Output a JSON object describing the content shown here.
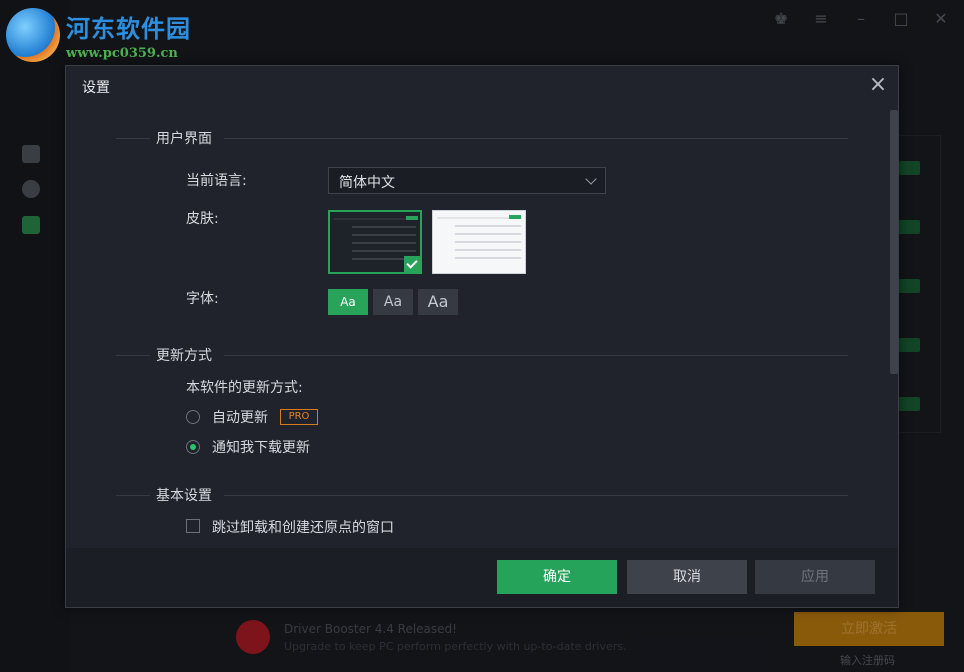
{
  "watermark": {
    "site_name": "河东软件园",
    "url": "www.pc0359.cn"
  },
  "background": {
    "banner_title": "Driver Booster 4.4 Released!",
    "banner_sub": "Upgrade to keep PC perform perfectly with up-to-date drivers.",
    "banner_button": "立即激活",
    "banner_link": "输入注册码"
  },
  "dialog": {
    "title": "设置",
    "sections": {
      "ui": "用户界面",
      "update": "更新方式",
      "basic": "基本设置"
    },
    "language": {
      "label": "当前语言:",
      "value": "简体中文"
    },
    "skin": {
      "label": "皮肤:"
    },
    "font": {
      "label": "字体:",
      "options": [
        "Aa",
        "Aa",
        "Aa"
      ]
    },
    "update": {
      "prompt": "本软件的更新方式:",
      "auto": "自动更新",
      "pro_badge": "PRO",
      "notify": "通知我下载更新"
    },
    "basic": {
      "skip_restore": "跳过卸载和创建还原点的窗口"
    },
    "buttons": {
      "ok": "确定",
      "cancel": "取消",
      "apply": "应用"
    }
  },
  "colors": {
    "accent": "#25a35a",
    "pro": "#e0842a"
  }
}
